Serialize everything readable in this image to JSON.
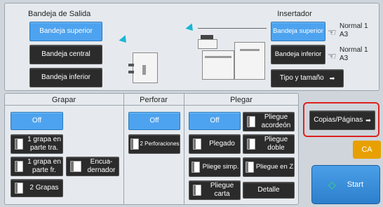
{
  "output_tray": {
    "title": "Bandeja de Salida",
    "top": "Bandeja superior",
    "center": "Bandeja central",
    "bottom": "Bandeja inferior"
  },
  "inserter": {
    "title": "Insertador",
    "upper": "Bandeja superior",
    "lower": "Bandeja inferior",
    "upper_paper": "Normal 1",
    "upper_size": "A3",
    "lower_paper": "Normal 1",
    "lower_size": "A3",
    "type_size": "Tipo y tamaño",
    "type_size_arrow": "➡"
  },
  "staple": {
    "title": "Grapar",
    "off": "Off",
    "one_back": "1 grapa en parte tra.",
    "one_front": "1 grapa en parte fr.",
    "binder": "Encua-dernador",
    "two": "2 Grapas"
  },
  "punch": {
    "title": "Perforar",
    "off": "Off",
    "two_holes": "2 Perforaciones"
  },
  "fold": {
    "title": "Plegar",
    "off": "Off",
    "accordion": "Pliegue acordeón",
    "folded": "Plegado",
    "double": "Pliegue doble",
    "single": "Pliege simp.",
    "z": "Pliegue en Z",
    "letter": "Pliegue carta",
    "detail": "Detalle"
  },
  "actions": {
    "copies_pages": "Copias/Páginas",
    "copies_arrow": "➡",
    "ca": "CA",
    "start": "Start",
    "start_icon": "◇"
  },
  "colors": {
    "selected": "#4da3ef",
    "accent_arrow": "#19b6d6",
    "highlight": "#e02020",
    "ca": "#e8a000",
    "start": "#2d7fcc"
  }
}
